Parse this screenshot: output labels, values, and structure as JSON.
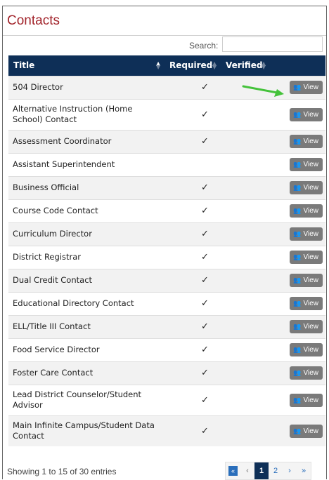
{
  "page": {
    "title": "Contacts",
    "search_label": "Search:",
    "search_value": ""
  },
  "table": {
    "headers": {
      "title": "Title",
      "required": "Required",
      "verified": "Verified"
    },
    "view_label": "View",
    "rows": [
      {
        "title": "504 Director",
        "required": "✓",
        "lines": 1
      },
      {
        "title": "Alternative Instruction (Home School) Contact",
        "required": "✓",
        "lines": 2
      },
      {
        "title": "Assessment Coordinator",
        "required": "✓",
        "lines": 1
      },
      {
        "title": "Assistant Superintendent",
        "required": "",
        "lines": 1
      },
      {
        "title": "Business Official",
        "required": "✓",
        "lines": 1
      },
      {
        "title": "Course Code Contact",
        "required": "✓",
        "lines": 1
      },
      {
        "title": "Curriculum Director",
        "required": "✓",
        "lines": 1
      },
      {
        "title": "District Registrar",
        "required": "✓",
        "lines": 1
      },
      {
        "title": "Dual Credit Contact",
        "required": "✓",
        "lines": 1
      },
      {
        "title": "Educational Directory Contact",
        "required": "✓",
        "lines": 1
      },
      {
        "title": "ELL/Title III Contact",
        "required": "✓",
        "lines": 1
      },
      {
        "title": "Food Service Director",
        "required": "✓",
        "lines": 1
      },
      {
        "title": "Foster Care Contact",
        "required": "✓",
        "lines": 1
      },
      {
        "title": "Lead District Counselor/Student Advisor",
        "required": "✓",
        "lines": 2
      },
      {
        "title": "Main Infinite Campus/Student Data Contact",
        "required": "✓",
        "lines": 2
      }
    ]
  },
  "footer": {
    "info": "Showing 1 to 15 of 30 entries",
    "pager": {
      "first": "«",
      "prev": "‹",
      "pages": [
        "1",
        "2"
      ],
      "next": "›",
      "last": "»"
    }
  },
  "colors": {
    "title": "#a3262d",
    "header_bg": "#0e2f57",
    "view_button": "#7a7a7a",
    "annotation_arrow": "#44c23a"
  },
  "icons": {
    "view": "users-icon",
    "sort": "sort-icon"
  }
}
